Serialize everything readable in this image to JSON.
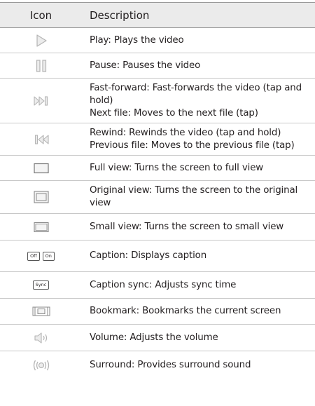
{
  "header": {
    "icon_col": "Icon",
    "desc_col": "Description"
  },
  "rows": [
    {
      "icon": "play-icon",
      "lines": [
        "Play: Plays the video"
      ]
    },
    {
      "icon": "pause-icon",
      "lines": [
        "Pause: Pauses the video"
      ]
    },
    {
      "icon": "fast-forward-icon",
      "lines": [
        "Fast-forward: Fast-forwards the video (tap and",
        "hold)",
        "Next file: Moves to the next file (tap)"
      ]
    },
    {
      "icon": "rewind-icon",
      "lines": [
        "Rewind: Rewinds the video (tap and hold)",
        "Previous file: Moves to the previous file (tap)"
      ]
    },
    {
      "icon": "full-view-icon",
      "lines": [
        "Full view: Turns the screen to full view"
      ]
    },
    {
      "icon": "original-view-icon",
      "lines": [
        "Original view: Turns the screen to the original",
        "view"
      ]
    },
    {
      "icon": "small-view-icon",
      "lines": [
        "Small view: Turns the screen to small view"
      ]
    },
    {
      "icon": "caption-toggle-icon",
      "icon_labels": [
        "Off",
        "On"
      ],
      "lines": [
        "Caption: Displays caption"
      ]
    },
    {
      "icon": "caption-sync-icon",
      "icon_labels": [
        "Sync"
      ],
      "lines": [
        "Caption sync: Adjusts sync time"
      ]
    },
    {
      "icon": "bookmark-icon",
      "lines": [
        "Bookmark: Bookmarks the current screen"
      ]
    },
    {
      "icon": "volume-icon",
      "lines": [
        "Volume: Adjusts the volume"
      ]
    },
    {
      "icon": "surround-icon",
      "lines": [
        "Surround: Provides surround sound"
      ]
    }
  ],
  "colors": {
    "icon_stroke": "#b5b5b5",
    "icon_fill": "#ececec",
    "header_bg": "#ebebeb",
    "text": "#231f20"
  }
}
